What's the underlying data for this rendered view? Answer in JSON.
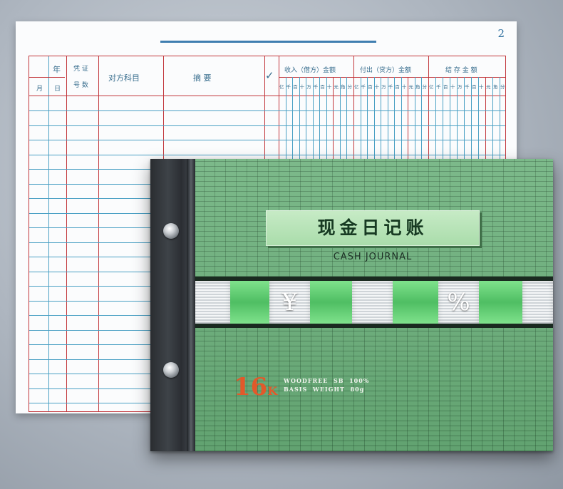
{
  "ledger": {
    "page_number": "2",
    "headers": {
      "year": "年",
      "month": "月",
      "day": "日",
      "voucher_top": "凭 证",
      "voucher_bottom": "号 数",
      "account": "对方科目",
      "summary": "摘      要",
      "check": "✓",
      "income": "收入（借方）金额",
      "payment": "付出（贷方）金额",
      "balance": "结  存  金  额"
    },
    "digit_units": [
      "亿",
      "千",
      "百",
      "十",
      "万",
      "千",
      "百",
      "十",
      "元",
      "角",
      "分"
    ]
  },
  "cover": {
    "title_cn": "现金日记账",
    "title_en": "CASH JOURNAL",
    "band_symbols": [
      "¥",
      "%"
    ],
    "size_number": "16",
    "size_suffix": "K",
    "spec_line1": "WOODFREE  SB  100%",
    "spec_line2": "BASIS  WEIGHT  80g",
    "colors": {
      "cover_green": "#6ab07a",
      "band_green": "#4fbe63",
      "accent_orange": "#e2592a",
      "ledger_red": "#c2363b",
      "ledger_blue": "#4aa0c4"
    }
  }
}
